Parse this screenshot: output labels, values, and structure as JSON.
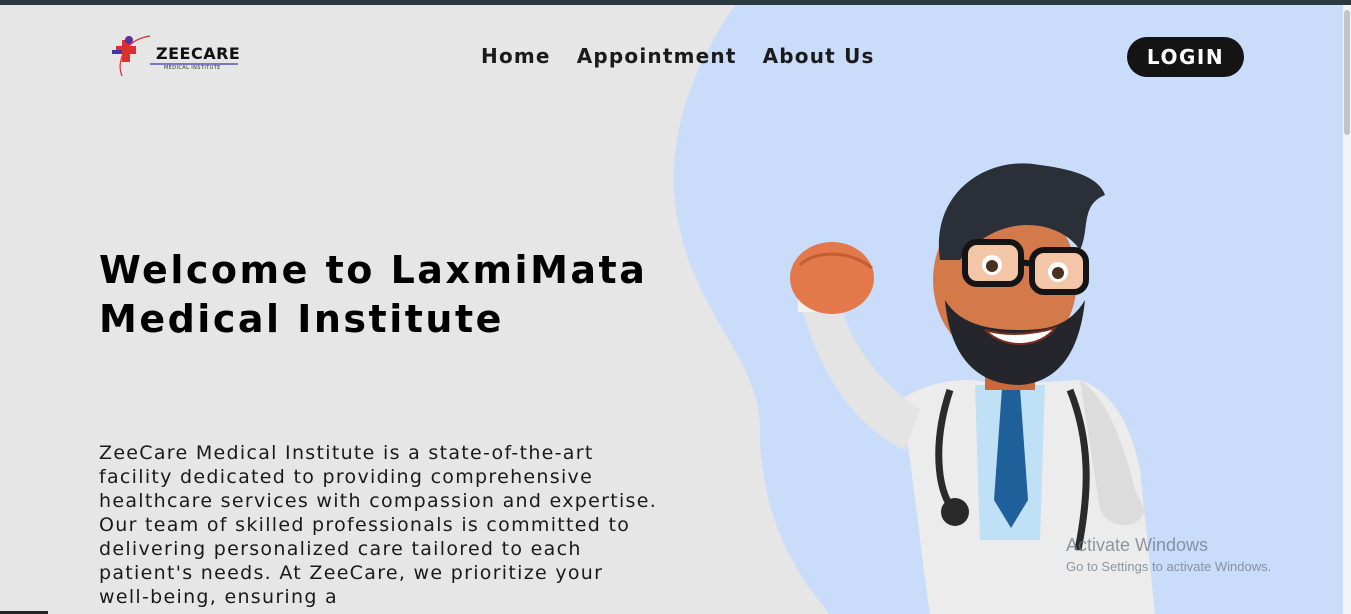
{
  "brand": {
    "name": "ZEECARE",
    "subtitle": "MEDICAL INSTITUTE"
  },
  "nav": {
    "items": [
      {
        "label": "Home"
      },
      {
        "label": "Appointment"
      },
      {
        "label": "About Us"
      }
    ]
  },
  "login_label": "LOGIN",
  "hero": {
    "title": "Welcome to LaxmiMata Medical Institute",
    "description": "ZeeCare Medical Institute is a state-of-the-art facility dedicated to providing comprehensive healthcare services with compassion and expertise. Our team of skilled professionals is committed to delivering personalized care tailored to each patient's needs. At ZeeCare, we prioritize your well-being, ensuring a"
  },
  "watermark": {
    "line1": "Activate Windows",
    "line2": "Go to Settings to activate Windows."
  },
  "colors": {
    "background": "#e6e6e6",
    "accent_blob": "#c9dcfa",
    "button": "#141414"
  }
}
